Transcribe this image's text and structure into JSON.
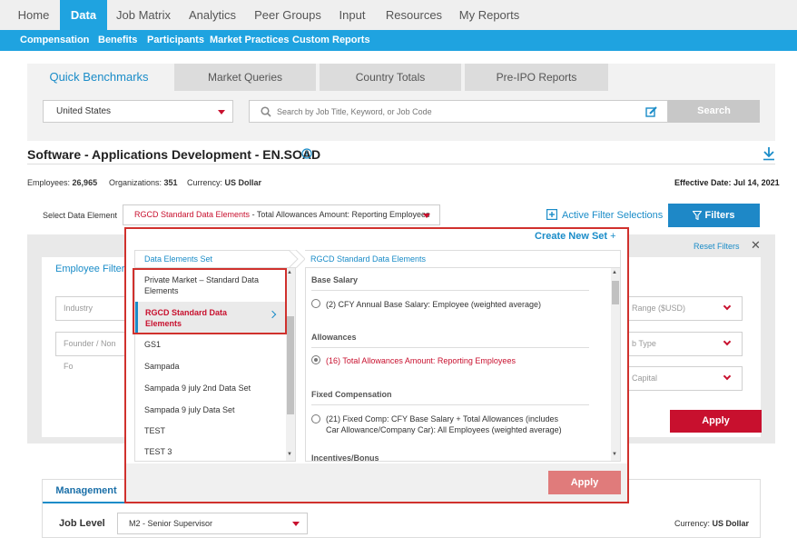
{
  "topnav": {
    "items": [
      "Home",
      "Data",
      "Job Matrix",
      "Analytics",
      "Peer Groups",
      "Input",
      "Resources",
      "My Reports"
    ]
  },
  "subnav": {
    "items": [
      "Compensation",
      "Benefits",
      "Participants",
      "Market Practices",
      "Custom Reports"
    ]
  },
  "tabs": [
    "Quick Benchmarks",
    "Market Queries",
    "Country Totals",
    "Pre-IPO Reports"
  ],
  "search": {
    "country": "United States",
    "placeholder": "Search by Job Title, Keyword, or Job Code",
    "button": "Search"
  },
  "job": {
    "title": "Software - Applications Development - EN.SOAD",
    "employees_label": "Employees:",
    "employees": "26,965",
    "orgs_label": "Organizations:",
    "orgs": "351",
    "currency_label": "Currency:",
    "currency": "US Dollar",
    "effective_label": "Effective Date:",
    "effective": "Jul 14, 2021"
  },
  "data_element": {
    "label": "Select Data Element",
    "prefix": "RGCD Standard Data Elements",
    "suffix": " - Total Allowances Amount: Reporting Employees"
  },
  "active_filter": "Active Filter Selections",
  "filters_button": "Filters",
  "reset_filters": "Reset Filters",
  "employee_filters": {
    "title": "Employee Filters",
    "fields": [
      "Industry",
      "Founder / Non Fo"
    ],
    "right_fields": [
      "Range ($USD)",
      "b Type",
      "Capital"
    ],
    "apply": "Apply"
  },
  "modal": {
    "create_new_set": "Create New Set",
    "left_header": "Data Elements Set",
    "right_header": "RGCD Standard Data Elements",
    "sets": [
      "Private Market – Standard Data Elements",
      "RGCD Standard Data Elements",
      "GS1",
      "Sampada",
      "Sampada 9 july 2nd Data Set",
      "Sampada 9 july Data Set",
      "TEST",
      "TEST 3"
    ],
    "sections": [
      {
        "title": "Base Salary",
        "option": "(2) CFY Annual Base Salary: Employee (weighted average)"
      },
      {
        "title": "Allowances",
        "option": "(16) Total Allowances Amount: Reporting Employees"
      },
      {
        "title": "Fixed Compensation",
        "option": "(21) Fixed Comp: CFY Base Salary + Total Allowances (includes Car Allowance/Company Car): All Employees (weighted average)"
      },
      {
        "title": "Incentives/Bonus",
        "option": ""
      }
    ],
    "apply": "Apply"
  },
  "bottom": {
    "tab": "Management",
    "job_level_label": "Job Level",
    "job_level_value": "M2 - Senior Supervisor",
    "currency_label": "Currency:",
    "currency": "US Dollar"
  },
  "colors": {
    "accent": "#1fa3e0",
    "red": "#c8102e",
    "highlight_border": "#d0312d"
  }
}
